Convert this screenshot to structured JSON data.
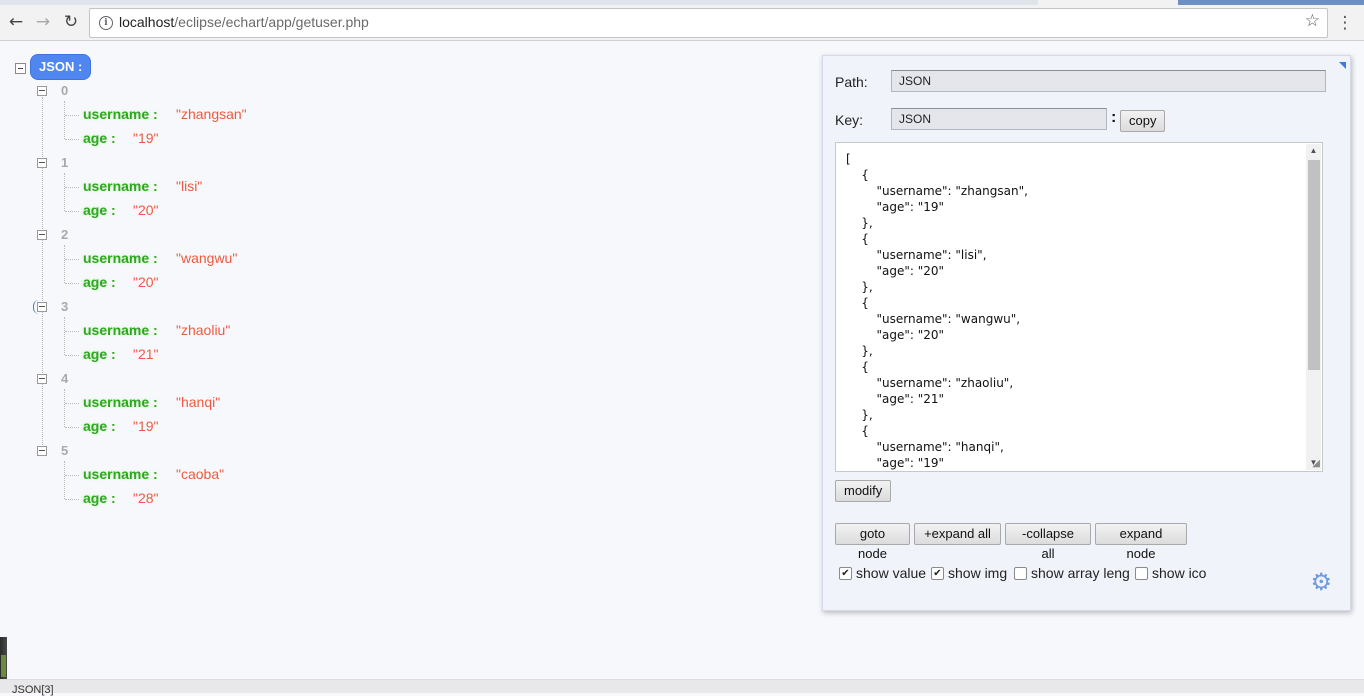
{
  "browser": {
    "url_host": "localhost",
    "url_path": "/eclipse/echart/app/getuser.php",
    "back_icon": "arrow-left-icon",
    "forward_icon": "arrow-right-icon",
    "reload_icon": "reload-icon",
    "bookmark_icon": "star-icon",
    "menu_icon": "kebab-menu-icon"
  },
  "tree": {
    "root_label": "JSON :",
    "items": [
      {
        "index": "0",
        "username_key": "username :",
        "username_val": "\"zhangsan\"",
        "age_key": "age :",
        "age_val": "\"19\""
      },
      {
        "index": "1",
        "username_key": "username :",
        "username_val": "\"lisi\"",
        "age_key": "age :",
        "age_val": "\"20\""
      },
      {
        "index": "2",
        "username_key": "username :",
        "username_val": "\"wangwu\"",
        "age_key": "age :",
        "age_val": "\"20\""
      },
      {
        "index": "3",
        "username_key": "username :",
        "username_val": "\"zhaoliu\"",
        "age_key": "age :",
        "age_val": "\"21\""
      },
      {
        "index": "4",
        "username_key": "username :",
        "username_val": "\"hanqi\"",
        "age_key": "age :",
        "age_val": "\"19\""
      },
      {
        "index": "5",
        "username_key": "username :",
        "username_val": "\"caoba\"",
        "age_key": "age :",
        "age_val": "\"28\""
      }
    ]
  },
  "panel": {
    "path_label": "Path:",
    "path_value": "JSON",
    "key_label": "Key:",
    "key_value": "JSON",
    "key_colon": ":",
    "copy_label": "copy",
    "json_text": "[\n    {\n        \"username\": \"zhangsan\",\n        \"age\": \"19\"\n    },\n    {\n        \"username\": \"lisi\",\n        \"age\": \"20\"\n    },\n    {\n        \"username\": \"wangwu\",\n        \"age\": \"20\"\n    },\n    {\n        \"username\": \"zhaoliu\",\n        \"age\": \"21\"\n    },\n    {\n        \"username\": \"hanqi\",\n        \"age\": \"19\"",
    "modify_label": "modify",
    "goto_node_label": "goto node",
    "expand_all_label": "+expand all",
    "collapse_all_label": "-collapse all",
    "expand_node_label": "expand node",
    "show_value_label": "show value",
    "show_value_checked": true,
    "show_img_label": "show img",
    "show_img_checked": true,
    "show_array_leng_label": "show array leng",
    "show_array_leng_checked": false,
    "show_ico_label": "show ico",
    "show_ico_checked": false,
    "settings_icon": "gear-icon"
  },
  "status": {
    "text": "JSON[3]"
  },
  "colors": {
    "root_pill": "#4f86f0",
    "key_green": "#2ea81f",
    "value_red": "#ee5a3f",
    "index_gray": "#a9a9a9"
  }
}
